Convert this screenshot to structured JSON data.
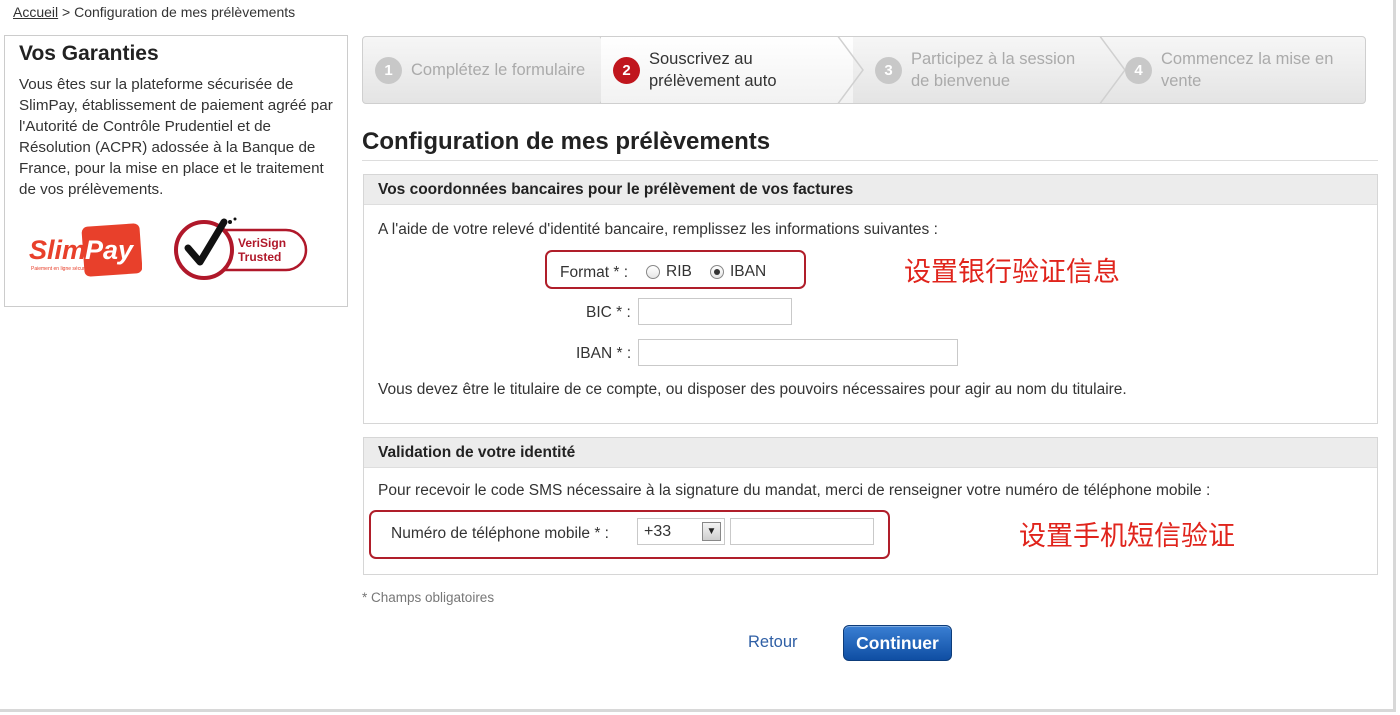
{
  "breadcrumb": {
    "home": "Accueil",
    "separator": ">",
    "current": "Configuration de mes prélèvements"
  },
  "sidebar": {
    "title": "Vos Garanties",
    "text": "Vous êtes sur la plateforme sécurisée de SlimPay, établissement de paiement agréé par l'Autorité de Contrôle Prudentiel et de Résolution (ACPR) adossée à la Banque de France, pour la mise en place et le traitement de vos prélèvements.",
    "logos": {
      "slimpay": {
        "word1": "Slim",
        "word2": "Pay",
        "tagline": "Paiement en ligne sécurisé",
        "color": "#e8402b"
      },
      "verisign": {
        "line1": "VeriSign",
        "line2": "Trusted",
        "color": "#b0182a"
      }
    }
  },
  "steps": [
    {
      "num": "1",
      "label": "Complétez le formulaire",
      "active": false
    },
    {
      "num": "2",
      "label": "Souscrivez au prélèvement auto",
      "active": true
    },
    {
      "num": "3",
      "label": "Participez à la session de bienvenue",
      "active": false
    },
    {
      "num": "4",
      "label": "Commencez la mise en vente",
      "active": false
    }
  ],
  "page_title": "Configuration de mes prélèvements",
  "bank_panel": {
    "header": "Vos coordonnées bancaires pour le prélèvement de vos factures",
    "intro": "A l'aide de votre relevé d'identité bancaire, remplissez les informations suivantes :",
    "format_label": "Format * :",
    "format_options": [
      "RIB",
      "IBAN"
    ],
    "format_selected": "IBAN",
    "bic_label": "BIC * :",
    "bic_value": "",
    "iban_label": "IBAN * :",
    "iban_value": "",
    "holder_note": "Vous devez être le titulaire de ce compte, ou disposer des pouvoirs nécessaires pour agir au nom du titulaire."
  },
  "identity_panel": {
    "header": "Validation de votre identité",
    "intro": "Pour recevoir le code SMS nécessaire à la signature du mandat, merci de renseigner votre numéro de téléphone mobile :",
    "phone_label": "Numéro de téléphone mobile * :",
    "country_code": "+33",
    "phone_value": ""
  },
  "annotations": {
    "bank": "设置银行验证信息",
    "sms": "设置手机短信验证",
    "color": "#e0241c"
  },
  "required_note": "* Champs obligatoires",
  "actions": {
    "back": "Retour",
    "continue": "Continuer"
  }
}
